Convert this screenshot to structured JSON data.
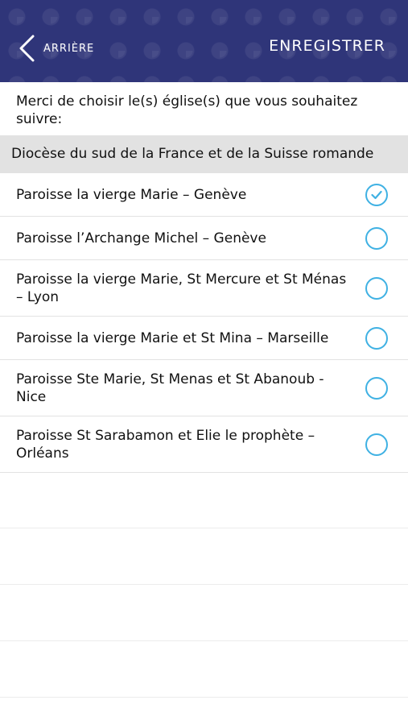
{
  "header": {
    "back_label": "ARRIÈRE",
    "save_label": "ENREGISTRER",
    "background_color": "#2f3579"
  },
  "intro": {
    "text": "Merci de choisir le(s) église(s) que vous souhaitez suivre:"
  },
  "section": {
    "title": "Diocèse du sud de la France et de la Suisse romande"
  },
  "parishes": [
    {
      "label": "Paroisse la vierge Marie – Genève",
      "selected": true
    },
    {
      "label": "Paroisse l’Archange Michel – Genève",
      "selected": false
    },
    {
      "label": "Paroisse la vierge Marie, St Mercure et St Ménas – Lyon",
      "selected": false
    },
    {
      "label": "Paroisse la vierge Marie et St Mina – Marseille",
      "selected": false
    },
    {
      "label": "Paroisse Ste Marie, St Menas et St Abanoub - Nice",
      "selected": false
    },
    {
      "label": "Paroisse St Sarabamon et Elie le prophète – Orléans",
      "selected": false
    }
  ],
  "colors": {
    "accent": "#3fb1e3",
    "section_bg": "#e2e2e2"
  }
}
